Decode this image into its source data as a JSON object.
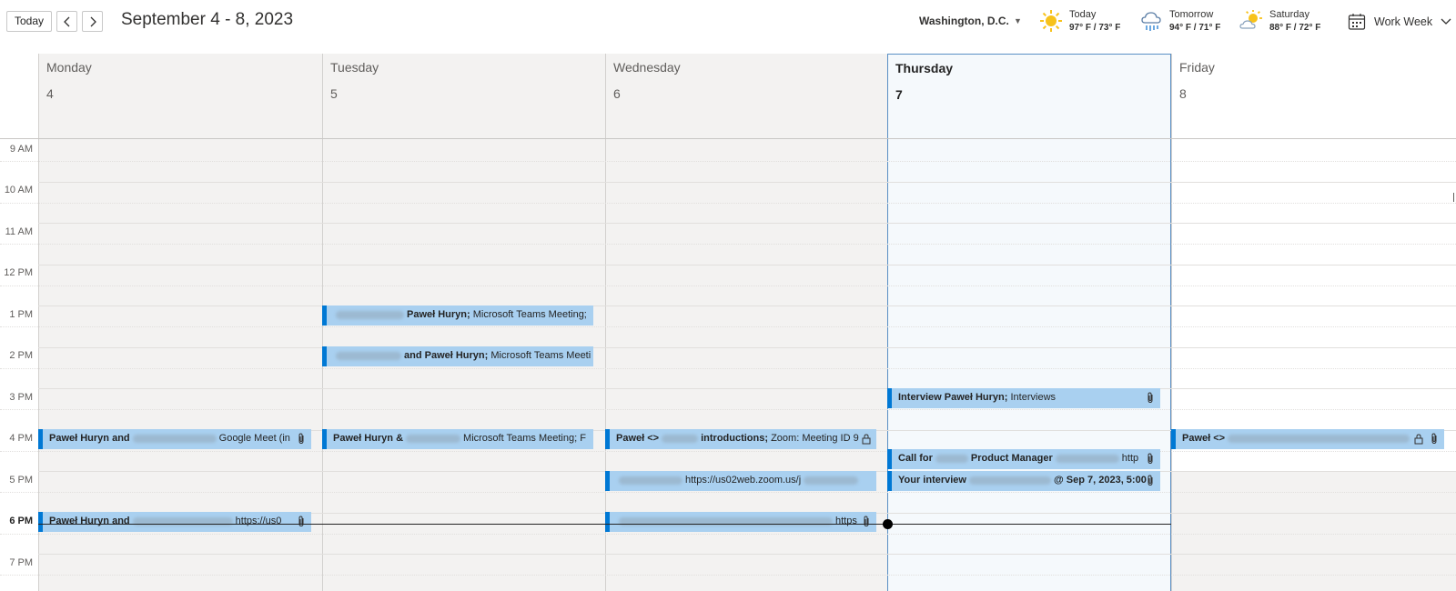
{
  "toolbar": {
    "today_label": "Today",
    "date_range": "September 4 - 8, 2023",
    "location": "Washington, D.C.",
    "view_label": "Work Week"
  },
  "weather": [
    {
      "label": "Today",
      "temp": "97° F / 73° F",
      "icon": "sun-icon"
    },
    {
      "label": "Tomorrow",
      "temp": "94° F / 71° F",
      "icon": "rain-cloud-icon"
    },
    {
      "label": "Saturday",
      "temp": "88° F / 72° F",
      "icon": "partly-sunny-icon"
    }
  ],
  "days": [
    {
      "name": "Monday",
      "num": "4"
    },
    {
      "name": "Tuesday",
      "num": "5"
    },
    {
      "name": "Wednesday",
      "num": "6"
    },
    {
      "name": "Thursday",
      "num": "7"
    },
    {
      "name": "Friday",
      "num": "8"
    }
  ],
  "times": [
    "9 AM",
    "10 AM",
    "11 AM",
    "12 PM",
    "1 PM",
    "2 PM",
    "3 PM",
    "4 PM",
    "5 PM",
    "6 PM",
    "7 PM"
  ],
  "events": {
    "tue_1pm": {
      "bold": "Paweł Huryn;",
      "text": " Microsoft Teams Meeting;"
    },
    "tue_2pm": {
      "bold": "and Paweł Huryn;",
      "text": " Microsoft Teams Meeti"
    },
    "thu_3pm": {
      "bold": "Interview Paweł Huryn;",
      "text": " Interviews"
    },
    "mon_4pm": {
      "bold": "Paweł Huryn and",
      "text": "Google Meet (in"
    },
    "tue_4pm": {
      "bold": "Paweł Huryn &",
      "text": "Microsoft Teams Meeting; F"
    },
    "wed_4pm": {
      "bold": "Paweł <>",
      "bold2": "introductions;",
      "text": " Zoom: Meeting ID 9"
    },
    "fri_4pm": {
      "bold": "Paweł <>",
      "text": ""
    },
    "thu_call": {
      "bold": "Call for",
      "bold2": "Product Manager",
      "text": "http"
    },
    "wed_5pm": {
      "bold": "",
      "text": "https://us02web.zoom.us/j"
    },
    "thu_interview": {
      "bold": "Your interview",
      "bold2": "@ Sep 7, 2023, 5:00",
      "text": ""
    },
    "mon_6pm": {
      "bold": "Paweł Huryn and",
      "text": "https://us0"
    },
    "wed_6pm": {
      "bold": "",
      "text": "https"
    }
  },
  "colors": {
    "event_bg": "#a9d0f0",
    "event_accent": "#0078d4",
    "today_border": "#5a8fc4"
  }
}
